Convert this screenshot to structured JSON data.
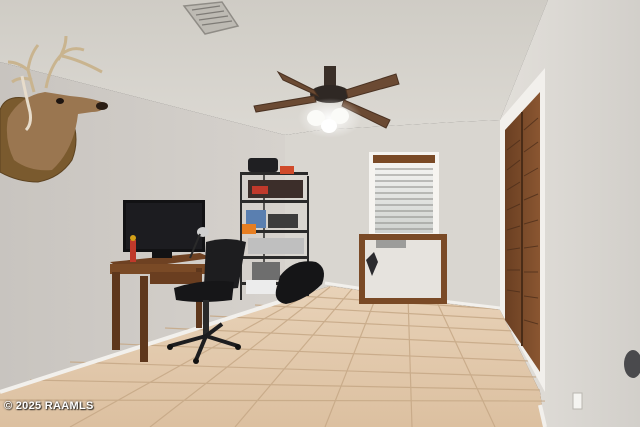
{
  "photo": {
    "watermark": "© 2025 RAAMLS"
  },
  "colors": {
    "ceiling": "#d6d3cd",
    "wall_left": "#cfcbc6",
    "wall_back": "#d8d5cf",
    "wall_right": "#dedbd6",
    "floor_tile": "#e2c9ad",
    "grout": "#c9ad8e",
    "wood": "#7a4a26",
    "dark": "#1d1d1f"
  }
}
